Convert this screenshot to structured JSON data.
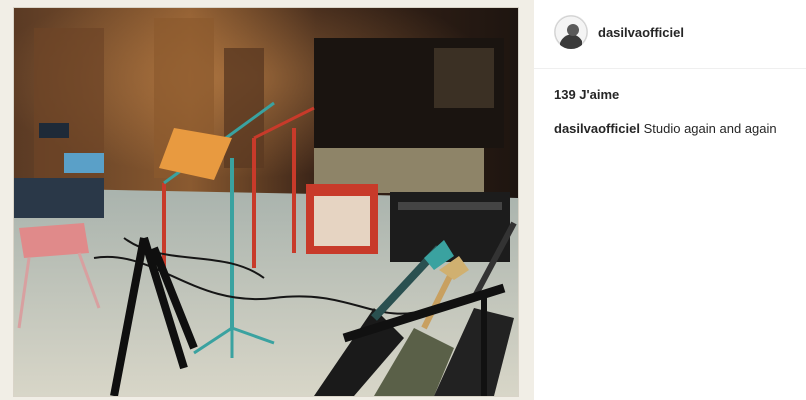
{
  "post": {
    "username": "dasilvaofficiel",
    "likes_text": "139 J'aime",
    "caption_user": "dasilvaofficiel",
    "caption_text": "Studio again and again"
  },
  "photo": {
    "subject": "recording studio with microphone stands, amplifiers and guitars",
    "icon": "photo-image"
  },
  "avatar": {
    "icon": "user-avatar"
  }
}
